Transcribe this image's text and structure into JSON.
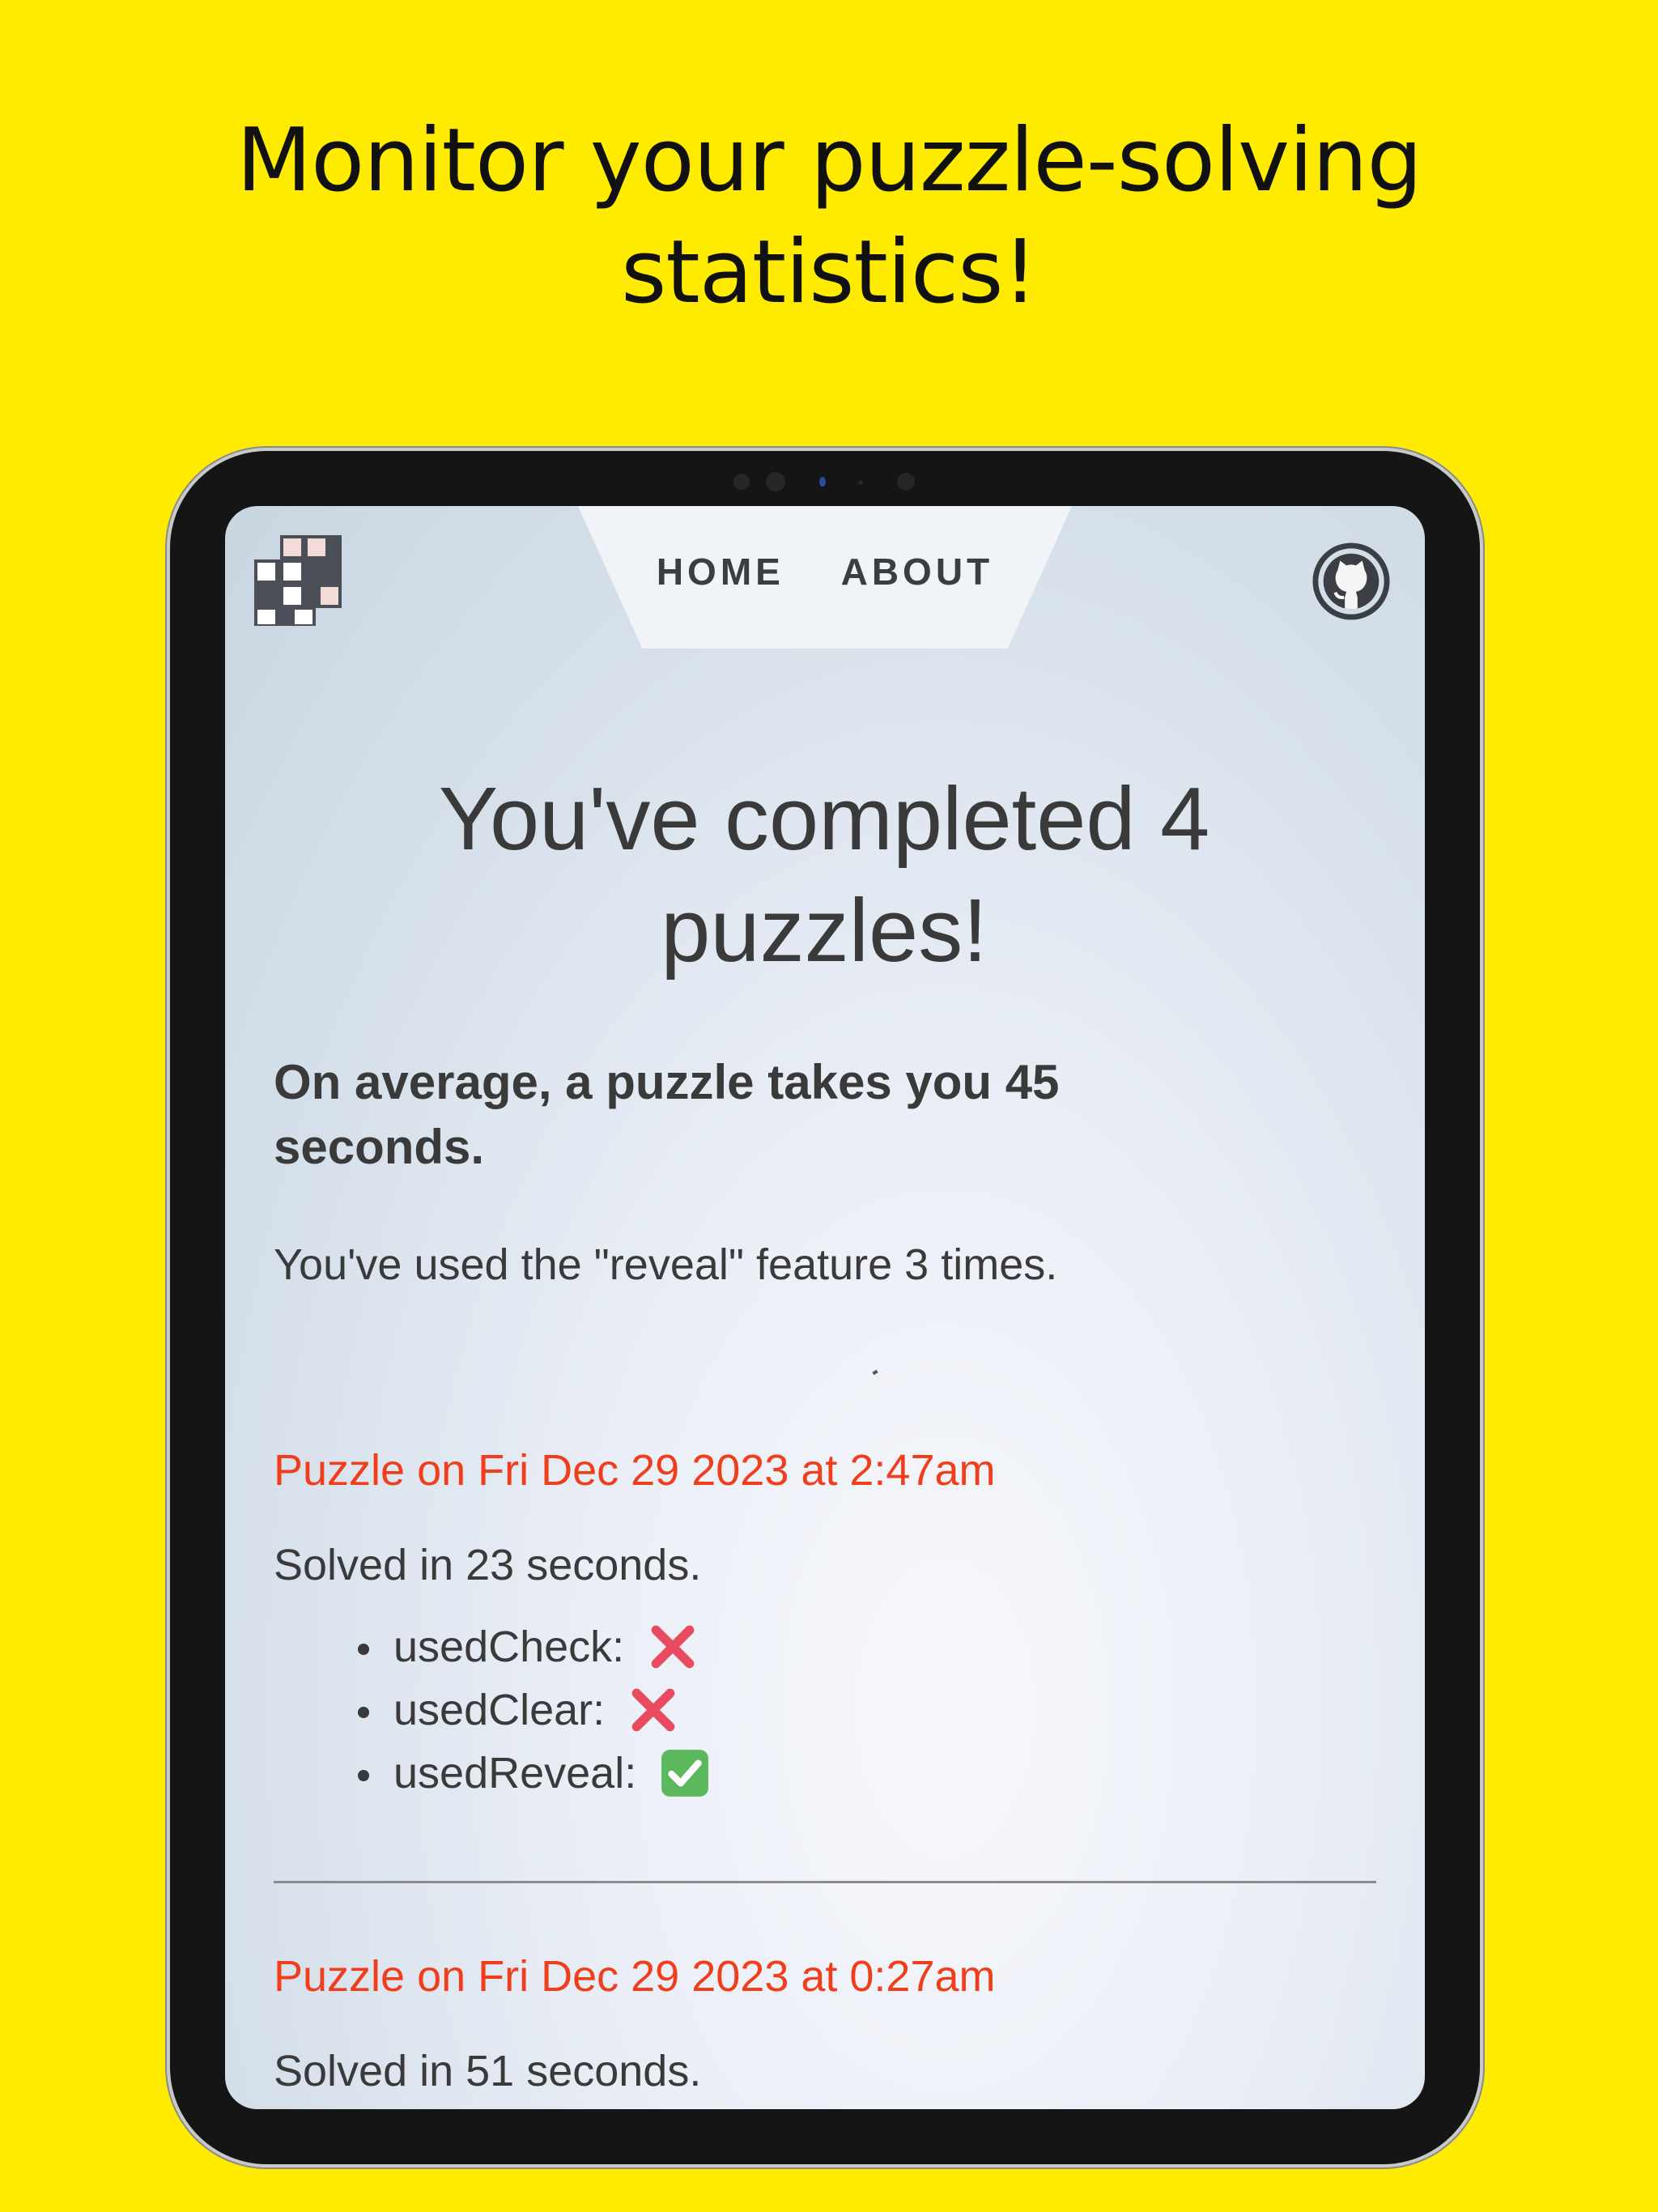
{
  "headline": {
    "line1": "Monitor your puzzle-solving",
    "line2": "statistics!"
  },
  "nav": {
    "home": "HOME",
    "about": "ABOUT"
  },
  "icons": {
    "logo": "crossword-grid-logo",
    "github": "github-icon"
  },
  "stats": {
    "completed": "You've completed 4 puzzles!",
    "average": "On average, a puzzle takes you 45 seconds.",
    "reveal": "You've used the \"reveal\" feature 3 times."
  },
  "puzzles": [
    {
      "title": "Puzzle on Fri Dec 29 2023 at 2:47am",
      "solved": "Solved in 23 seconds.",
      "flags": [
        {
          "label": "usedCheck:",
          "value": false
        },
        {
          "label": "usedClear:",
          "value": false
        },
        {
          "label": "usedReveal:",
          "value": true
        }
      ]
    },
    {
      "title": "Puzzle on Fri Dec 29 2023 at 0:27am",
      "solved": "Solved in 51 seconds."
    }
  ],
  "colors": {
    "background": "#FFEB00",
    "accent": "#f03e1c",
    "cross": "#e84a5f",
    "check": "#5cb85c"
  }
}
